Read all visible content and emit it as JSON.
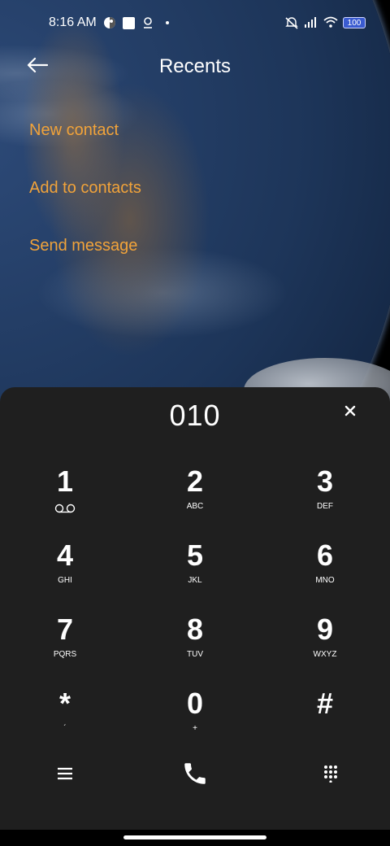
{
  "status_bar": {
    "time": "8:16 AM",
    "battery": "100",
    "icons": [
      "color-palette-icon",
      "square-notification-icon",
      "location-icon",
      "dot-icon",
      "mute-icon",
      "signal-icon",
      "wifi-icon",
      "battery-icon"
    ]
  },
  "header": {
    "title": "Recents",
    "back_icon": "back-arrow-icon"
  },
  "menu": {
    "items": [
      {
        "label": "New contact"
      },
      {
        "label": "Add to contacts"
      },
      {
        "label": "Send message"
      }
    ],
    "accent_color": "#f1a33a"
  },
  "dialer": {
    "number": "010",
    "clear_icon": "close-icon",
    "keys": [
      {
        "digit": "1",
        "sub": ""
      },
      {
        "digit": "2",
        "sub": "ABC"
      },
      {
        "digit": "3",
        "sub": "DEF"
      },
      {
        "digit": "4",
        "sub": "GHI"
      },
      {
        "digit": "5",
        "sub": "JKL"
      },
      {
        "digit": "6",
        "sub": "MNO"
      },
      {
        "digit": "7",
        "sub": "PQRS"
      },
      {
        "digit": "8",
        "sub": "TUV"
      },
      {
        "digit": "9",
        "sub": "WXYZ"
      },
      {
        "digit": "*",
        "sub": "´"
      },
      {
        "digit": "0",
        "sub": "+"
      },
      {
        "digit": "#",
        "sub": ""
      }
    ],
    "bottom_icons": [
      "menu-icon",
      "phone-call-icon",
      "keypad-icon"
    ],
    "panel_color": "#1f1f1f"
  }
}
